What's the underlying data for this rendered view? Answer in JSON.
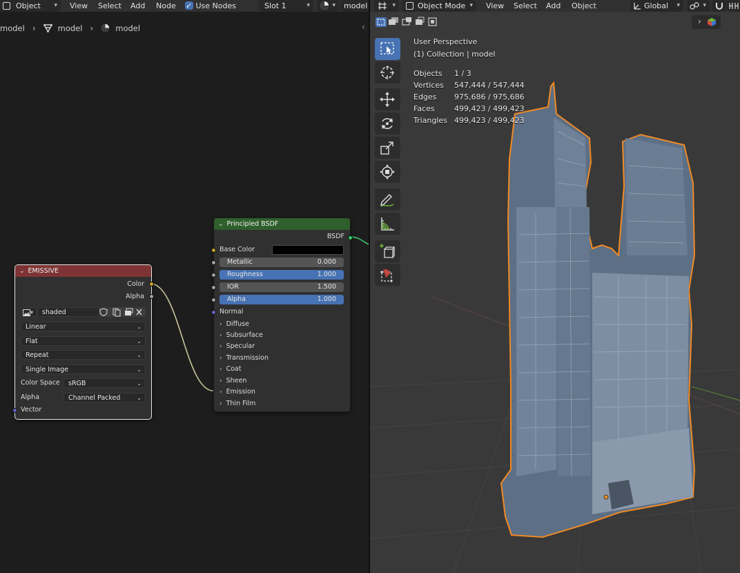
{
  "node_editor": {
    "header": {
      "object_dropdown": "Object",
      "menus": [
        "View",
        "Select",
        "Add",
        "Node"
      ],
      "use_nodes_label": "Use Nodes",
      "use_nodes_checked": true,
      "slot_dropdown": "Slot 1",
      "material_name": "model"
    },
    "breadcrumb": [
      "model",
      "model",
      "model"
    ],
    "image_node": {
      "title": "EMISSIVE",
      "outputs": [
        "Color",
        "Alpha"
      ],
      "image_name": "shaded",
      "interpolation": "Linear",
      "projection": "Flat",
      "extension": "Repeat",
      "source": "Single Image",
      "color_space_label": "Color Space",
      "color_space": "sRGB",
      "alpha_label": "Alpha",
      "alpha_mode": "Channel Packed",
      "input": "Vector",
      "header_color": "#7e3434"
    },
    "bsdf_node": {
      "title": "Principled BSDF",
      "output": "BSDF",
      "base_color_label": "Base Color",
      "base_color_value": "#000000",
      "metallic_label": "Metallic",
      "metallic_value": "0.000",
      "roughness_label": "Roughness",
      "roughness_value": "1.000",
      "ior_label": "IOR",
      "ior_value": "1.500",
      "alpha_label": "Alpha",
      "alpha_value": "1.000",
      "normal_label": "Normal",
      "panels": [
        "Diffuse",
        "Subsurface",
        "Specular",
        "Transmission",
        "Coat",
        "Sheen",
        "Emission",
        "Thin Film"
      ],
      "header_color": "#2f5f2c"
    }
  },
  "viewport": {
    "header": {
      "mode_dropdown": "Object Mode",
      "menus": [
        "View",
        "Select",
        "Add",
        "Object"
      ],
      "orientation_dropdown": "Global"
    },
    "overlay": {
      "view_name": "User Perspective",
      "collection": "(1) Collection | model",
      "stats": [
        {
          "label": "Objects",
          "value": "1 / 3"
        },
        {
          "label": "Vertices",
          "value": "547,444 / 547,444"
        },
        {
          "label": "Edges",
          "value": "975,686 / 975,686"
        },
        {
          "label": "Faces",
          "value": "499,423 / 499,423"
        },
        {
          "label": "Triangles",
          "value": "499,423 / 499,423"
        }
      ]
    },
    "toolbar_tools": [
      "select-box",
      "cursor",
      "move",
      "rotate",
      "scale",
      "transform",
      "annotate",
      "measure",
      "add-cube",
      "scale-cage"
    ],
    "selection_outline_color": "#f08a24",
    "active_tool_color": "#4772b3"
  }
}
